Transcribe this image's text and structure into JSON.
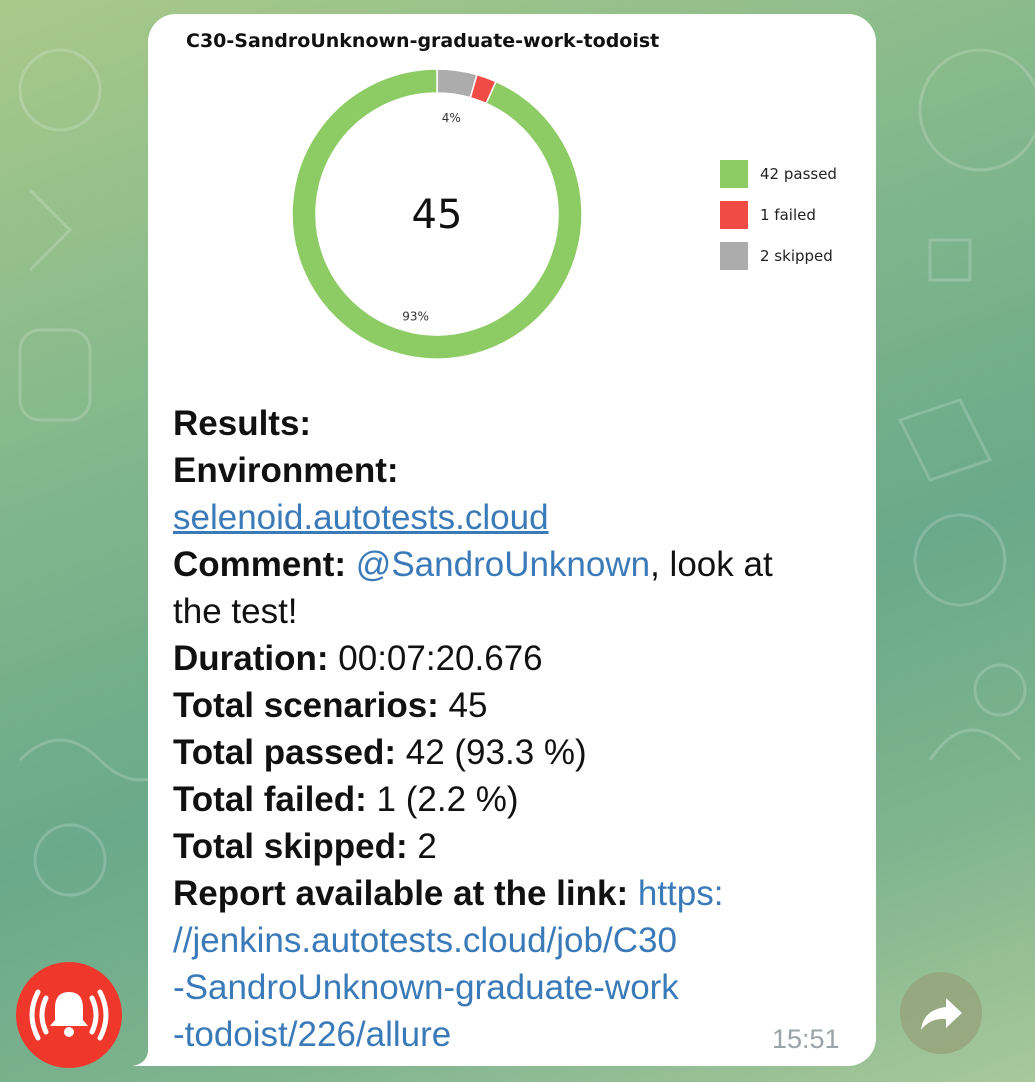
{
  "report": {
    "title": "C30-SandroUnknown-graduate-work-todoist",
    "total": "45"
  },
  "chart_data": {
    "type": "pie",
    "title": "C30-SandroUnknown-graduate-work-todoist",
    "center_label": "45",
    "slices": [
      {
        "label": "42 passed",
        "value": 42,
        "percent_label": "93%",
        "color": "#8dcc64"
      },
      {
        "label": "1 failed",
        "value": 1,
        "percent_label": "",
        "color": "#f04c45"
      },
      {
        "label": "2 skipped",
        "value": 2,
        "percent_label": "4%",
        "color": "#acacac"
      }
    ],
    "legend": "right"
  },
  "message": {
    "results_label": "Results:",
    "environment_label": "Environment:",
    "environment_link": "selenoid.autotests.cloud",
    "comment_label": "Comment:",
    "comment_mention": "@SandroUnknown",
    "comment_text_1": ", look at",
    "comment_text_2": "the test!",
    "duration_label": "Duration:",
    "duration_value": " 00:07:20.676",
    "scenarios_label": "Total scenarios:",
    "scenarios_value": " 45",
    "passed_label": "Total passed:",
    "passed_value": " 42 (93.3 %)",
    "failed_label": "Total failed:",
    "failed_value": " 1 (2.2 %)",
    "skipped_label": "Total skipped:",
    "skipped_value": " 2",
    "report_label": "Report available at the link:",
    "report_link_1": " https:",
    "report_link_2": "//jenkins.autotests.cloud/job/C30",
    "report_link_3": "-SandroUnknown-graduate-work",
    "report_link_4": "-todoist/226/allure"
  },
  "timestamp": "15:51",
  "icons": {
    "alarm": "alarm-bell-icon",
    "forward": "forward-arrow-icon"
  },
  "colors": {
    "link": "#3a7ab8",
    "alarm_button": "#f0372c",
    "passed": "#8dcc64",
    "failed": "#f04c45",
    "skipped": "#acacac"
  }
}
